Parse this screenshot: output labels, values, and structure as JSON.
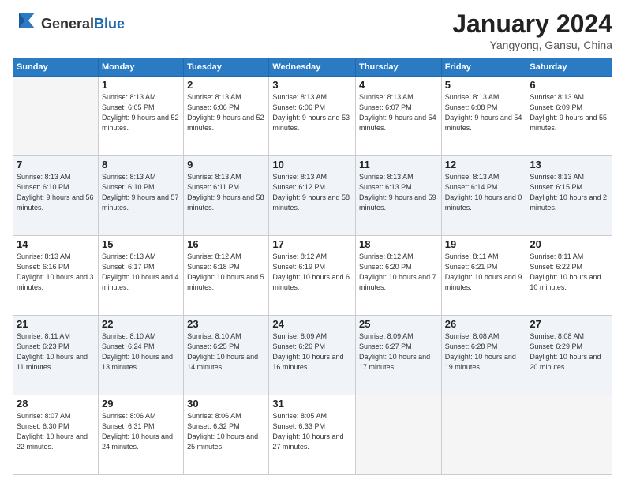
{
  "header": {
    "logo_general": "General",
    "logo_blue": "Blue",
    "title": "January 2024",
    "location": "Yangyong, Gansu, China"
  },
  "days_of_week": [
    "Sunday",
    "Monday",
    "Tuesday",
    "Wednesday",
    "Thursday",
    "Friday",
    "Saturday"
  ],
  "weeks": [
    [
      {
        "day": "",
        "sunrise": "",
        "sunset": "",
        "daylight": ""
      },
      {
        "day": "1",
        "sunrise": "Sunrise: 8:13 AM",
        "sunset": "Sunset: 6:05 PM",
        "daylight": "Daylight: 9 hours and 52 minutes."
      },
      {
        "day": "2",
        "sunrise": "Sunrise: 8:13 AM",
        "sunset": "Sunset: 6:06 PM",
        "daylight": "Daylight: 9 hours and 52 minutes."
      },
      {
        "day": "3",
        "sunrise": "Sunrise: 8:13 AM",
        "sunset": "Sunset: 6:06 PM",
        "daylight": "Daylight: 9 hours and 53 minutes."
      },
      {
        "day": "4",
        "sunrise": "Sunrise: 8:13 AM",
        "sunset": "Sunset: 6:07 PM",
        "daylight": "Daylight: 9 hours and 54 minutes."
      },
      {
        "day": "5",
        "sunrise": "Sunrise: 8:13 AM",
        "sunset": "Sunset: 6:08 PM",
        "daylight": "Daylight: 9 hours and 54 minutes."
      },
      {
        "day": "6",
        "sunrise": "Sunrise: 8:13 AM",
        "sunset": "Sunset: 6:09 PM",
        "daylight": "Daylight: 9 hours and 55 minutes."
      }
    ],
    [
      {
        "day": "7",
        "sunrise": "Sunrise: 8:13 AM",
        "sunset": "Sunset: 6:10 PM",
        "daylight": "Daylight: 9 hours and 56 minutes."
      },
      {
        "day": "8",
        "sunrise": "Sunrise: 8:13 AM",
        "sunset": "Sunset: 6:10 PM",
        "daylight": "Daylight: 9 hours and 57 minutes."
      },
      {
        "day": "9",
        "sunrise": "Sunrise: 8:13 AM",
        "sunset": "Sunset: 6:11 PM",
        "daylight": "Daylight: 9 hours and 58 minutes."
      },
      {
        "day": "10",
        "sunrise": "Sunrise: 8:13 AM",
        "sunset": "Sunset: 6:12 PM",
        "daylight": "Daylight: 9 hours and 58 minutes."
      },
      {
        "day": "11",
        "sunrise": "Sunrise: 8:13 AM",
        "sunset": "Sunset: 6:13 PM",
        "daylight": "Daylight: 9 hours and 59 minutes."
      },
      {
        "day": "12",
        "sunrise": "Sunrise: 8:13 AM",
        "sunset": "Sunset: 6:14 PM",
        "daylight": "Daylight: 10 hours and 0 minutes."
      },
      {
        "day": "13",
        "sunrise": "Sunrise: 8:13 AM",
        "sunset": "Sunset: 6:15 PM",
        "daylight": "Daylight: 10 hours and 2 minutes."
      }
    ],
    [
      {
        "day": "14",
        "sunrise": "Sunrise: 8:13 AM",
        "sunset": "Sunset: 6:16 PM",
        "daylight": "Daylight: 10 hours and 3 minutes."
      },
      {
        "day": "15",
        "sunrise": "Sunrise: 8:13 AM",
        "sunset": "Sunset: 6:17 PM",
        "daylight": "Daylight: 10 hours and 4 minutes."
      },
      {
        "day": "16",
        "sunrise": "Sunrise: 8:12 AM",
        "sunset": "Sunset: 6:18 PM",
        "daylight": "Daylight: 10 hours and 5 minutes."
      },
      {
        "day": "17",
        "sunrise": "Sunrise: 8:12 AM",
        "sunset": "Sunset: 6:19 PM",
        "daylight": "Daylight: 10 hours and 6 minutes."
      },
      {
        "day": "18",
        "sunrise": "Sunrise: 8:12 AM",
        "sunset": "Sunset: 6:20 PM",
        "daylight": "Daylight: 10 hours and 7 minutes."
      },
      {
        "day": "19",
        "sunrise": "Sunrise: 8:11 AM",
        "sunset": "Sunset: 6:21 PM",
        "daylight": "Daylight: 10 hours and 9 minutes."
      },
      {
        "day": "20",
        "sunrise": "Sunrise: 8:11 AM",
        "sunset": "Sunset: 6:22 PM",
        "daylight": "Daylight: 10 hours and 10 minutes."
      }
    ],
    [
      {
        "day": "21",
        "sunrise": "Sunrise: 8:11 AM",
        "sunset": "Sunset: 6:23 PM",
        "daylight": "Daylight: 10 hours and 11 minutes."
      },
      {
        "day": "22",
        "sunrise": "Sunrise: 8:10 AM",
        "sunset": "Sunset: 6:24 PM",
        "daylight": "Daylight: 10 hours and 13 minutes."
      },
      {
        "day": "23",
        "sunrise": "Sunrise: 8:10 AM",
        "sunset": "Sunset: 6:25 PM",
        "daylight": "Daylight: 10 hours and 14 minutes."
      },
      {
        "day": "24",
        "sunrise": "Sunrise: 8:09 AM",
        "sunset": "Sunset: 6:26 PM",
        "daylight": "Daylight: 10 hours and 16 minutes."
      },
      {
        "day": "25",
        "sunrise": "Sunrise: 8:09 AM",
        "sunset": "Sunset: 6:27 PM",
        "daylight": "Daylight: 10 hours and 17 minutes."
      },
      {
        "day": "26",
        "sunrise": "Sunrise: 8:08 AM",
        "sunset": "Sunset: 6:28 PM",
        "daylight": "Daylight: 10 hours and 19 minutes."
      },
      {
        "day": "27",
        "sunrise": "Sunrise: 8:08 AM",
        "sunset": "Sunset: 6:29 PM",
        "daylight": "Daylight: 10 hours and 20 minutes."
      }
    ],
    [
      {
        "day": "28",
        "sunrise": "Sunrise: 8:07 AM",
        "sunset": "Sunset: 6:30 PM",
        "daylight": "Daylight: 10 hours and 22 minutes."
      },
      {
        "day": "29",
        "sunrise": "Sunrise: 8:06 AM",
        "sunset": "Sunset: 6:31 PM",
        "daylight": "Daylight: 10 hours and 24 minutes."
      },
      {
        "day": "30",
        "sunrise": "Sunrise: 8:06 AM",
        "sunset": "Sunset: 6:32 PM",
        "daylight": "Daylight: 10 hours and 25 minutes."
      },
      {
        "day": "31",
        "sunrise": "Sunrise: 8:05 AM",
        "sunset": "Sunset: 6:33 PM",
        "daylight": "Daylight: 10 hours and 27 minutes."
      },
      {
        "day": "",
        "sunrise": "",
        "sunset": "",
        "daylight": ""
      },
      {
        "day": "",
        "sunrise": "",
        "sunset": "",
        "daylight": ""
      },
      {
        "day": "",
        "sunrise": "",
        "sunset": "",
        "daylight": ""
      }
    ]
  ]
}
